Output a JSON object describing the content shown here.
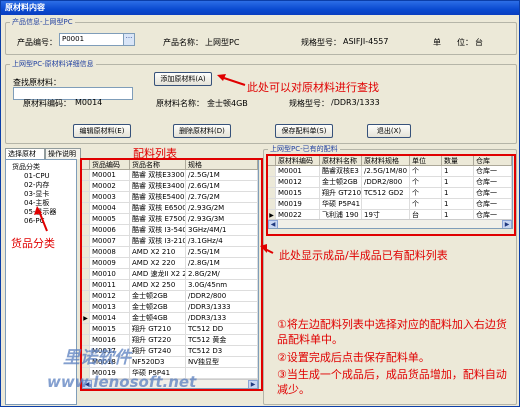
{
  "window": {
    "title": "原材料内容"
  },
  "product_info": {
    "legend": "产品信息-上网型PC",
    "code_label": "产品编号：",
    "code_value": "P0001",
    "name_label": "产品名称：",
    "name_value": "上网型PC",
    "spec_label": "规格型号：",
    "spec_value": "ASIFJI-4557",
    "unit_label": "单　　位：",
    "unit_value": "台"
  },
  "detail": {
    "legend": "上网型PC-原材料详细信息",
    "search_label": "查找原材料：",
    "search_value": "",
    "add_button": "添加原材料(A)",
    "code_label": "原材料编码：",
    "code_value": "M0014",
    "name_label": "原材料名称：",
    "name_value": "金士顿4GB",
    "spec_label": "规格型号：",
    "spec_value": "/DDR3/1333"
  },
  "buttons": {
    "edit": "编辑原材料(E)",
    "delete": "删除原材料(D)",
    "save": "保存配料单(S)",
    "exit": "退出(X)"
  },
  "tabs": [
    "选择原材料",
    "操作说明"
  ],
  "tree": {
    "root": "货品分类",
    "items": [
      "01-CPU",
      "02-内存",
      "03-显卡",
      "04-主板",
      "05-显示器",
      "06-PC"
    ]
  },
  "material_grid": {
    "columns": [
      "货品编码",
      "货品名称",
      "规格"
    ],
    "rows": [
      [
        "M0001",
        "酷睿 双核E3300",
        "/2.5G/1M"
      ],
      [
        "M0002",
        "酷睿 双核E3400",
        "/2.6G/1M"
      ],
      [
        "M0003",
        "酷睿 双核E5400",
        "/2.7G/2M"
      ],
      [
        "M0004",
        "酷睿 双核 E6500",
        "/2.93G/2M"
      ],
      [
        "M0005",
        "酷睿 双核 E7500",
        "/2.93G/3M"
      ],
      [
        "M0006",
        "酷睿 双核 I3-540",
        "3GHz/4M/1"
      ],
      [
        "M0007",
        "酷睿 双核 I3-2100",
        "/3.1GHz/4"
      ],
      [
        "M0008",
        "AMD X2 210",
        "/2.5G/1M"
      ],
      [
        "M0009",
        "AMD X2 220",
        "/2.8G/1M"
      ],
      [
        "M0010",
        "AMD 速龙II X2 240",
        "2.8G/2M/"
      ],
      [
        "M0011",
        "AMD X2 250",
        "3.0G/45nm"
      ],
      [
        "M0012",
        "金士顿2GB",
        "/DDR2/800"
      ],
      [
        "M0013",
        "金士顿2GB",
        "/DDR3/1333"
      ],
      [
        "M0014",
        "金士顿4GB",
        "/DDR3/133"
      ],
      [
        "M0015",
        "翔升 GT210",
        "TC512 DD"
      ],
      [
        "M0016",
        "翔升 GT220",
        "TC512 黄金"
      ],
      [
        "M0017",
        "翔升 GT240",
        "TC512 D3"
      ],
      [
        "M0018",
        "NF520D3",
        "NV独显型"
      ],
      [
        "M0019",
        "华硕 P5P41",
        ""
      ]
    ]
  },
  "bom": {
    "legend": "上网型PC-已有的配料",
    "columns": [
      "原材料编码",
      "原材料名称",
      "原材料规格",
      "单位",
      "数量",
      "仓库"
    ],
    "rows": [
      [
        "M0001",
        "酷睿双核E3",
        "/2.5G/1M/80",
        "个",
        "1",
        "仓库一"
      ],
      [
        "M0012",
        "金士顿2GB",
        "/DDR2/800",
        "个",
        "1",
        "仓库一"
      ],
      [
        "M0015",
        "翔升 GT210",
        "TC512 GD2",
        "个",
        "1",
        "仓库一"
      ],
      [
        "M0019",
        "华硕 P5P41",
        "",
        "个",
        "1",
        "仓库一"
      ],
      [
        "M0022",
        "飞利浦 190",
        "19寸",
        "台",
        "1",
        "仓库一"
      ]
    ]
  },
  "annotations": {
    "search_hint": "此处可以对原材料进行查找",
    "material_list": "配料列表",
    "category": "货品分类",
    "bom_hint": "此处显示成品/半成品已有配料列表",
    "step1": "①将左边配料列表中选择对应的配料加入右边货品配料单中。",
    "step2": "②设置完成后点击保存配料单。",
    "step3": "③当生成一个成品后，成品货品增加，配料自动减少。"
  },
  "watermark": {
    "line1": "里诺软件",
    "line2": "www.lenosoft.net"
  }
}
